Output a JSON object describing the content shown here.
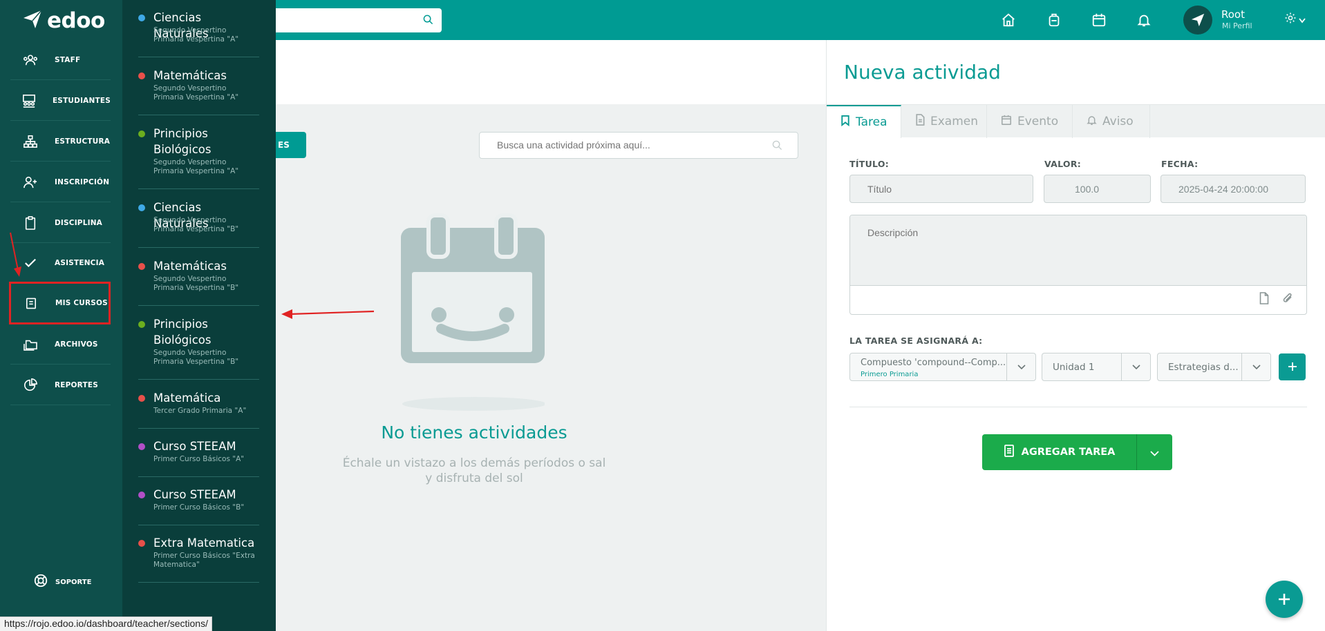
{
  "app": {
    "logo_text": "edoo",
    "user_name": "Root",
    "user_sub": "Mi Perfil"
  },
  "nav": [
    {
      "label": "STAFF",
      "icon": "users-icon"
    },
    {
      "label": "ESTUDIANTES",
      "icon": "classroom-icon"
    },
    {
      "label": "ESTRUCTURA",
      "icon": "sitemap-icon"
    },
    {
      "label": "INSCRIPCIÓN",
      "icon": "user-plus-icon"
    },
    {
      "label": "DISCIPLINA",
      "icon": "clipboard-icon"
    },
    {
      "label": "ASISTENCIA",
      "icon": "check-icon"
    },
    {
      "label": "MIS CURSOS",
      "icon": "book-icon"
    },
    {
      "label": "ARCHIVOS",
      "icon": "folders-icon"
    },
    {
      "label": "REPORTES",
      "icon": "pie-chart-icon"
    }
  ],
  "support_label": "SOPORTE",
  "courses": [
    {
      "name": "Ciencias Naturales",
      "sub": "Segundo Vespertino Primaria Vespertina \"A\"",
      "color": "#3fa9e6"
    },
    {
      "name": "Matemáticas",
      "sub": "Segundo Vespertino Primaria Vespertina \"A\"",
      "color": "#e8504a"
    },
    {
      "name": "Principios Biológicos",
      "sub": "Segundo Vespertino Primaria Vespertina \"A\"",
      "color": "#6cae1f"
    },
    {
      "name": "Ciencias Naturales",
      "sub": "Segundo Vespertino Primaria Vespertina \"B\"",
      "color": "#3fa9e6"
    },
    {
      "name": "Matemáticas",
      "sub": "Segundo Vespertino Primaria Vespertina \"B\"",
      "color": "#e8504a"
    },
    {
      "name": "Principios Biológicos",
      "sub": "Segundo Vespertino Primaria Vespertina \"B\"",
      "color": "#6cae1f"
    },
    {
      "name": "Matemática",
      "sub": "Tercer Grado Primaria \"A\"",
      "color": "#e8504a"
    },
    {
      "name": "Curso STEEAM",
      "sub": "Primer Curso Básicos \"A\"",
      "color": "#b14fc7"
    },
    {
      "name": "Curso STEEAM",
      "sub": "Primer Curso Básicos \"B\"",
      "color": "#b14fc7"
    },
    {
      "name": "Extra Matematica",
      "sub": "Primer Curso Básicos \"Extra Matematica\"",
      "color": "#e8504a"
    }
  ],
  "middle": {
    "button_label": "ES",
    "search_placeholder": "Busca una actividad próxima aquí...",
    "empty_title": "No tienes actividades",
    "empty_sub": "Échale un vistazo a los demás períodos o sal y disfruta del sol"
  },
  "form": {
    "title": "Nueva actividad",
    "tabs": [
      "Tarea",
      "Examen",
      "Evento",
      "Aviso"
    ],
    "titulo_label": "TÍTULO:",
    "titulo_placeholder": "Título",
    "valor_label": "VALOR:",
    "valor_value": "100.0",
    "fecha_label": "FECHA:",
    "fecha_value": "2025-04-24 20:00:00",
    "descripcion_placeholder": "Descripción",
    "assign_label": "LA TAREA SE ASIGNARÁ A:",
    "select_course": "Compuesto 'compound--Comp...",
    "select_course_sub": "Primero Primaria",
    "select_unit": "Unidad 1",
    "select_strategy": "Estrategias d...",
    "submit_label": "AGREGAR TAREA"
  },
  "status_url": "https://rojo.edoo.io/dashboard/teacher/sections/",
  "colors": {
    "brand": "#009b93",
    "nav_bg": "#0e4f4b",
    "submit": "#1bab4b",
    "highlight": "#e02323"
  }
}
